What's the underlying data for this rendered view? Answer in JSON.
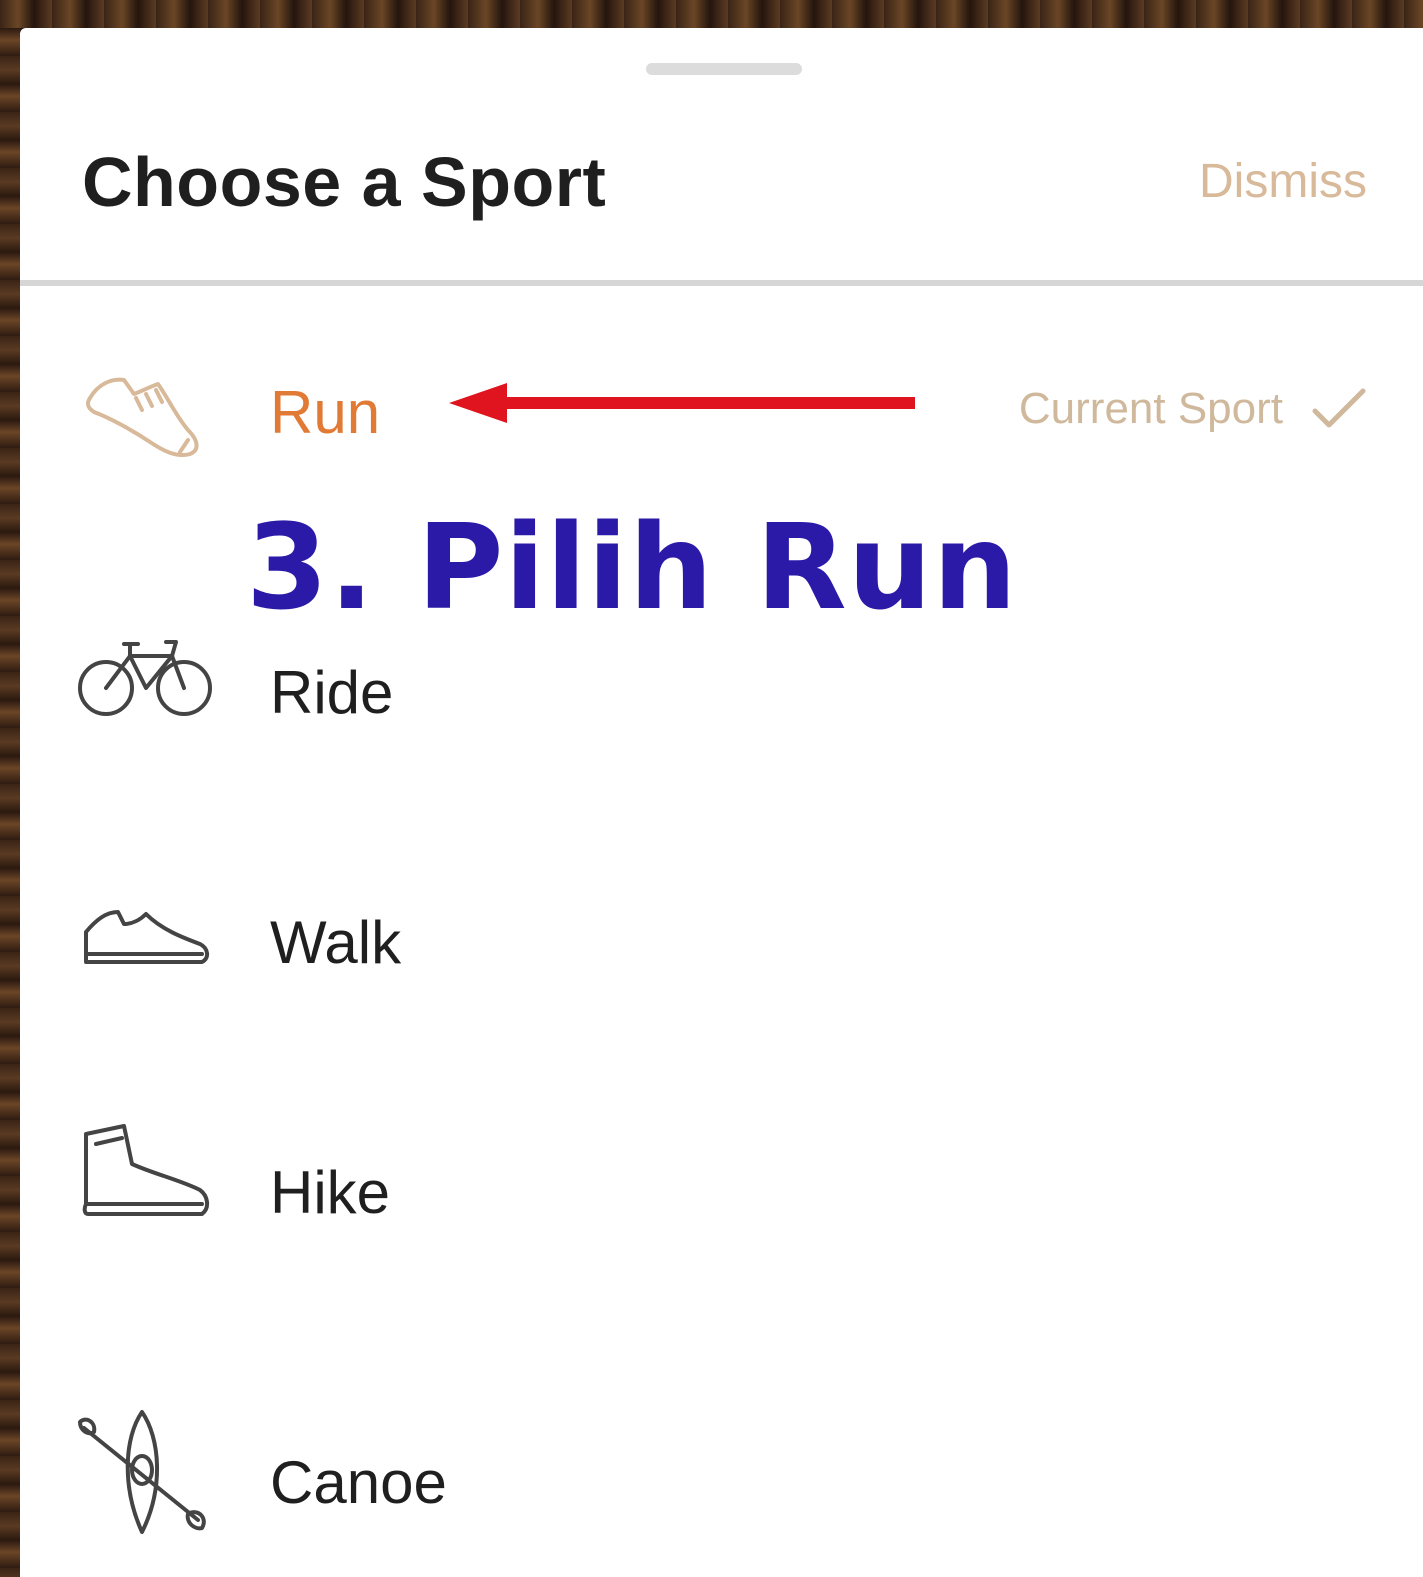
{
  "header": {
    "title": "Choose a Sport",
    "dismiss_label": "Dismiss"
  },
  "sports": [
    {
      "label": "Run",
      "icon": "running-shoe-icon",
      "current": true
    },
    {
      "label": "Ride",
      "icon": "bicycle-icon",
      "current": false
    },
    {
      "label": "Walk",
      "icon": "walking-shoe-icon",
      "current": false
    },
    {
      "label": "Hike",
      "icon": "hiking-boot-icon",
      "current": false
    },
    {
      "label": "Canoe",
      "icon": "canoe-icon",
      "current": false
    }
  ],
  "current_sport_label": "Current Sport",
  "annotation": {
    "text": "3. Pilih Run"
  },
  "colors": {
    "accent": "#e07a35",
    "muted_accent": "#d8b99a",
    "annotation_text": "#2b1aa8",
    "annotation_arrow": "#e0141e"
  }
}
